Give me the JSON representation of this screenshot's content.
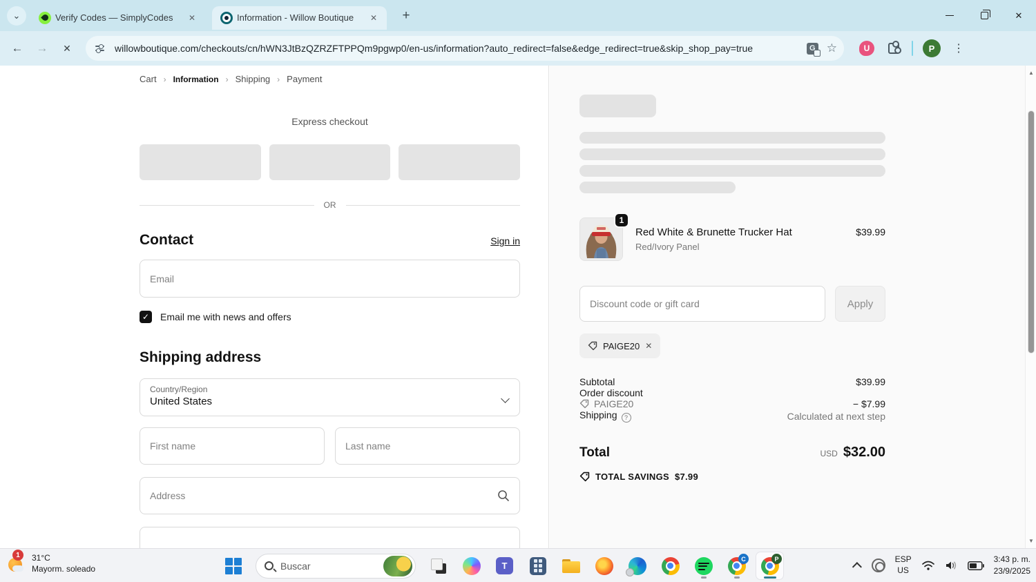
{
  "browser": {
    "tabs": [
      {
        "title": "Verify Codes — SimplyCodes"
      },
      {
        "title": "Information - Willow Boutique"
      }
    ],
    "url": "willowboutique.com/checkouts/cn/hWN3JtBzQZRZFTPPQm9pgwp0/en-us/information?auto_redirect=false&edge_redirect=true&skip_shop_pay=true",
    "profile_initial": "P",
    "extension_badge": "U"
  },
  "checkout": {
    "breadcrumb": [
      "Cart",
      "Information",
      "Shipping",
      "Payment"
    ],
    "express_label": "Express checkout",
    "or_label": "OR",
    "contact": {
      "title": "Contact",
      "signin": "Sign in",
      "email_placeholder": "Email",
      "newsletter_label": "Email me with news and offers"
    },
    "shipping": {
      "title": "Shipping address",
      "country_label": "Country/Region",
      "country_value": "United States",
      "first_name_placeholder": "First name",
      "last_name_placeholder": "Last name",
      "address_placeholder": "Address"
    }
  },
  "summary": {
    "product": {
      "name": "Red White & Brunette Trucker Hat",
      "variant": "Red/Ivory Panel",
      "price": "$39.99",
      "qty": "1"
    },
    "discount": {
      "placeholder": "Discount code or gift card",
      "apply_label": "Apply",
      "chip_code": "PAIGE20"
    },
    "rows": {
      "subtotal_label": "Subtotal",
      "subtotal": "$39.99",
      "order_discount_label": "Order discount",
      "discount_code": "PAIGE20",
      "discount_amount": "− $7.99",
      "shipping_label": "Shipping",
      "shipping_value": "Calculated at next step",
      "total_label": "Total",
      "currency": "USD",
      "total": "$32.00",
      "savings_label": "TOTAL SAVINGS",
      "savings_amount": "$7.99"
    }
  },
  "taskbar": {
    "weather": {
      "badge": "1",
      "temp": "31°C",
      "desc": "Mayorm. soleado"
    },
    "search_placeholder": "Buscar",
    "chrome_badge_c": "C",
    "chrome_badge_p": "P",
    "tray": {
      "lang_top": "ESP",
      "lang_bottom": "US",
      "time": "3:43 p. m.",
      "date": "23/9/2025"
    }
  }
}
